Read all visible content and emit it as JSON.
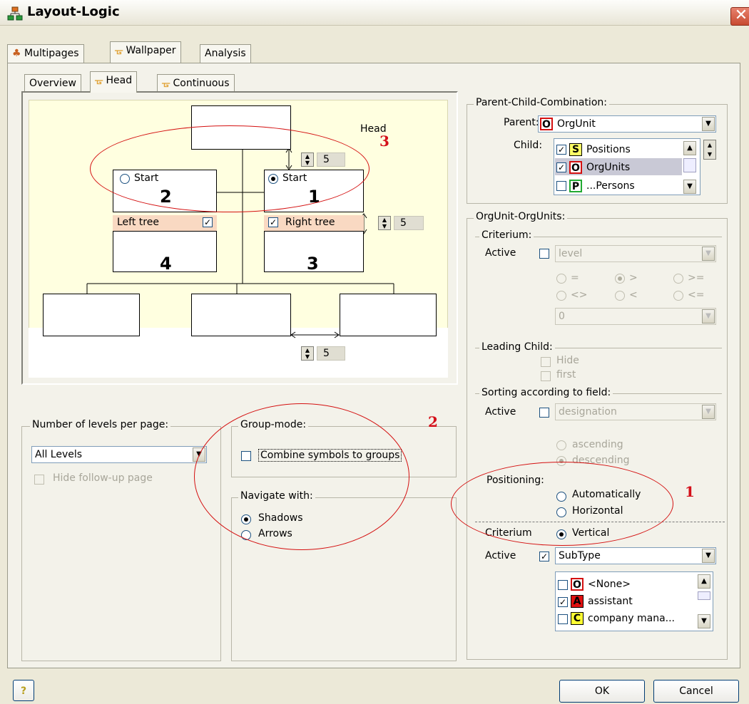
{
  "window": {
    "title": "Layout-Logic",
    "close_glyph": "✕"
  },
  "tabs_main": [
    {
      "label": "Multipages"
    },
    {
      "label": "Wallpaper"
    },
    {
      "label": "Analysis"
    }
  ],
  "tabs_sub": [
    {
      "label": "Overview"
    },
    {
      "label": "Head"
    },
    {
      "label": "Continuous"
    }
  ],
  "preview": {
    "head_label": "Head",
    "start_left": "Start",
    "start_left_num": "2",
    "start_right": "Start",
    "start_right_num": "1",
    "left_tree": "Left tree",
    "right_tree": "Right tree",
    "box_left_num": "4",
    "box_right_num": "3",
    "spacing_vertical": "5",
    "spacing_tree": "5",
    "spacing_horizontal": "5",
    "left_tree_checked": true,
    "right_tree_checked": true,
    "start_selected": "right"
  },
  "levels_group": {
    "title": "Number of levels per page:",
    "value": "All Levels",
    "hide_followup": "Hide follow-up page"
  },
  "groupmode": {
    "title": "Group-mode:",
    "combine": "Combine symbols to groups"
  },
  "navigate": {
    "title": "Navigate with:",
    "shadows": "Shadows",
    "arrows": "Arrows",
    "selected": "Shadows"
  },
  "pcc": {
    "title": "Parent-Child-Combination:",
    "parent_label": "Parent:",
    "parent_swatch": "O",
    "parent_value": "OrgUnit",
    "child_label": "Child:",
    "children": [
      {
        "swatch": "S",
        "label": "Positions",
        "checked": true
      },
      {
        "swatch": "O",
        "label": "OrgUnits",
        "checked": true
      },
      {
        "swatch": "P",
        "label": "...Persons",
        "checked": false
      }
    ]
  },
  "orgunit": {
    "title": "OrgUnit-OrgUnits:",
    "criterium_title": "Criterium:",
    "active_label": "Active",
    "field_value": "level",
    "ops": [
      "=",
      ">",
      ">=",
      "<>",
      "<",
      "<="
    ],
    "compare_value": "0",
    "leading_title": "Leading Child:",
    "hide": "Hide",
    "first": "first",
    "sorting_title": "Sorting according to field:",
    "sort_field": "designation",
    "ascending": "ascending",
    "descending": "descending",
    "positioning_title": "Positioning:",
    "automatically": "Automatically",
    "horizontal": "Horizontal",
    "vertical": "Vertical",
    "criterium2": "Criterium",
    "active2": "Active",
    "subtype_value": "SubType",
    "subtypes": [
      {
        "swatch": "O",
        "label": "<None>",
        "checked": false
      },
      {
        "swatch": "A",
        "label": "assistant",
        "checked": true
      },
      {
        "swatch": "C",
        "label": "company mana...",
        "checked": false
      }
    ]
  },
  "buttons": {
    "help": "?",
    "ok": "OK",
    "cancel": "Cancel"
  },
  "annotations": [
    "1",
    "2",
    "3",
    "3"
  ],
  "colors": {
    "preview_bg": "#ffffe0",
    "tree_label_bg": "#f9d9c2",
    "annotation_red": "#d41010",
    "swatch_o": "#d41010",
    "swatch_s": "#ffff66",
    "swatch_p": "#66cc66"
  }
}
